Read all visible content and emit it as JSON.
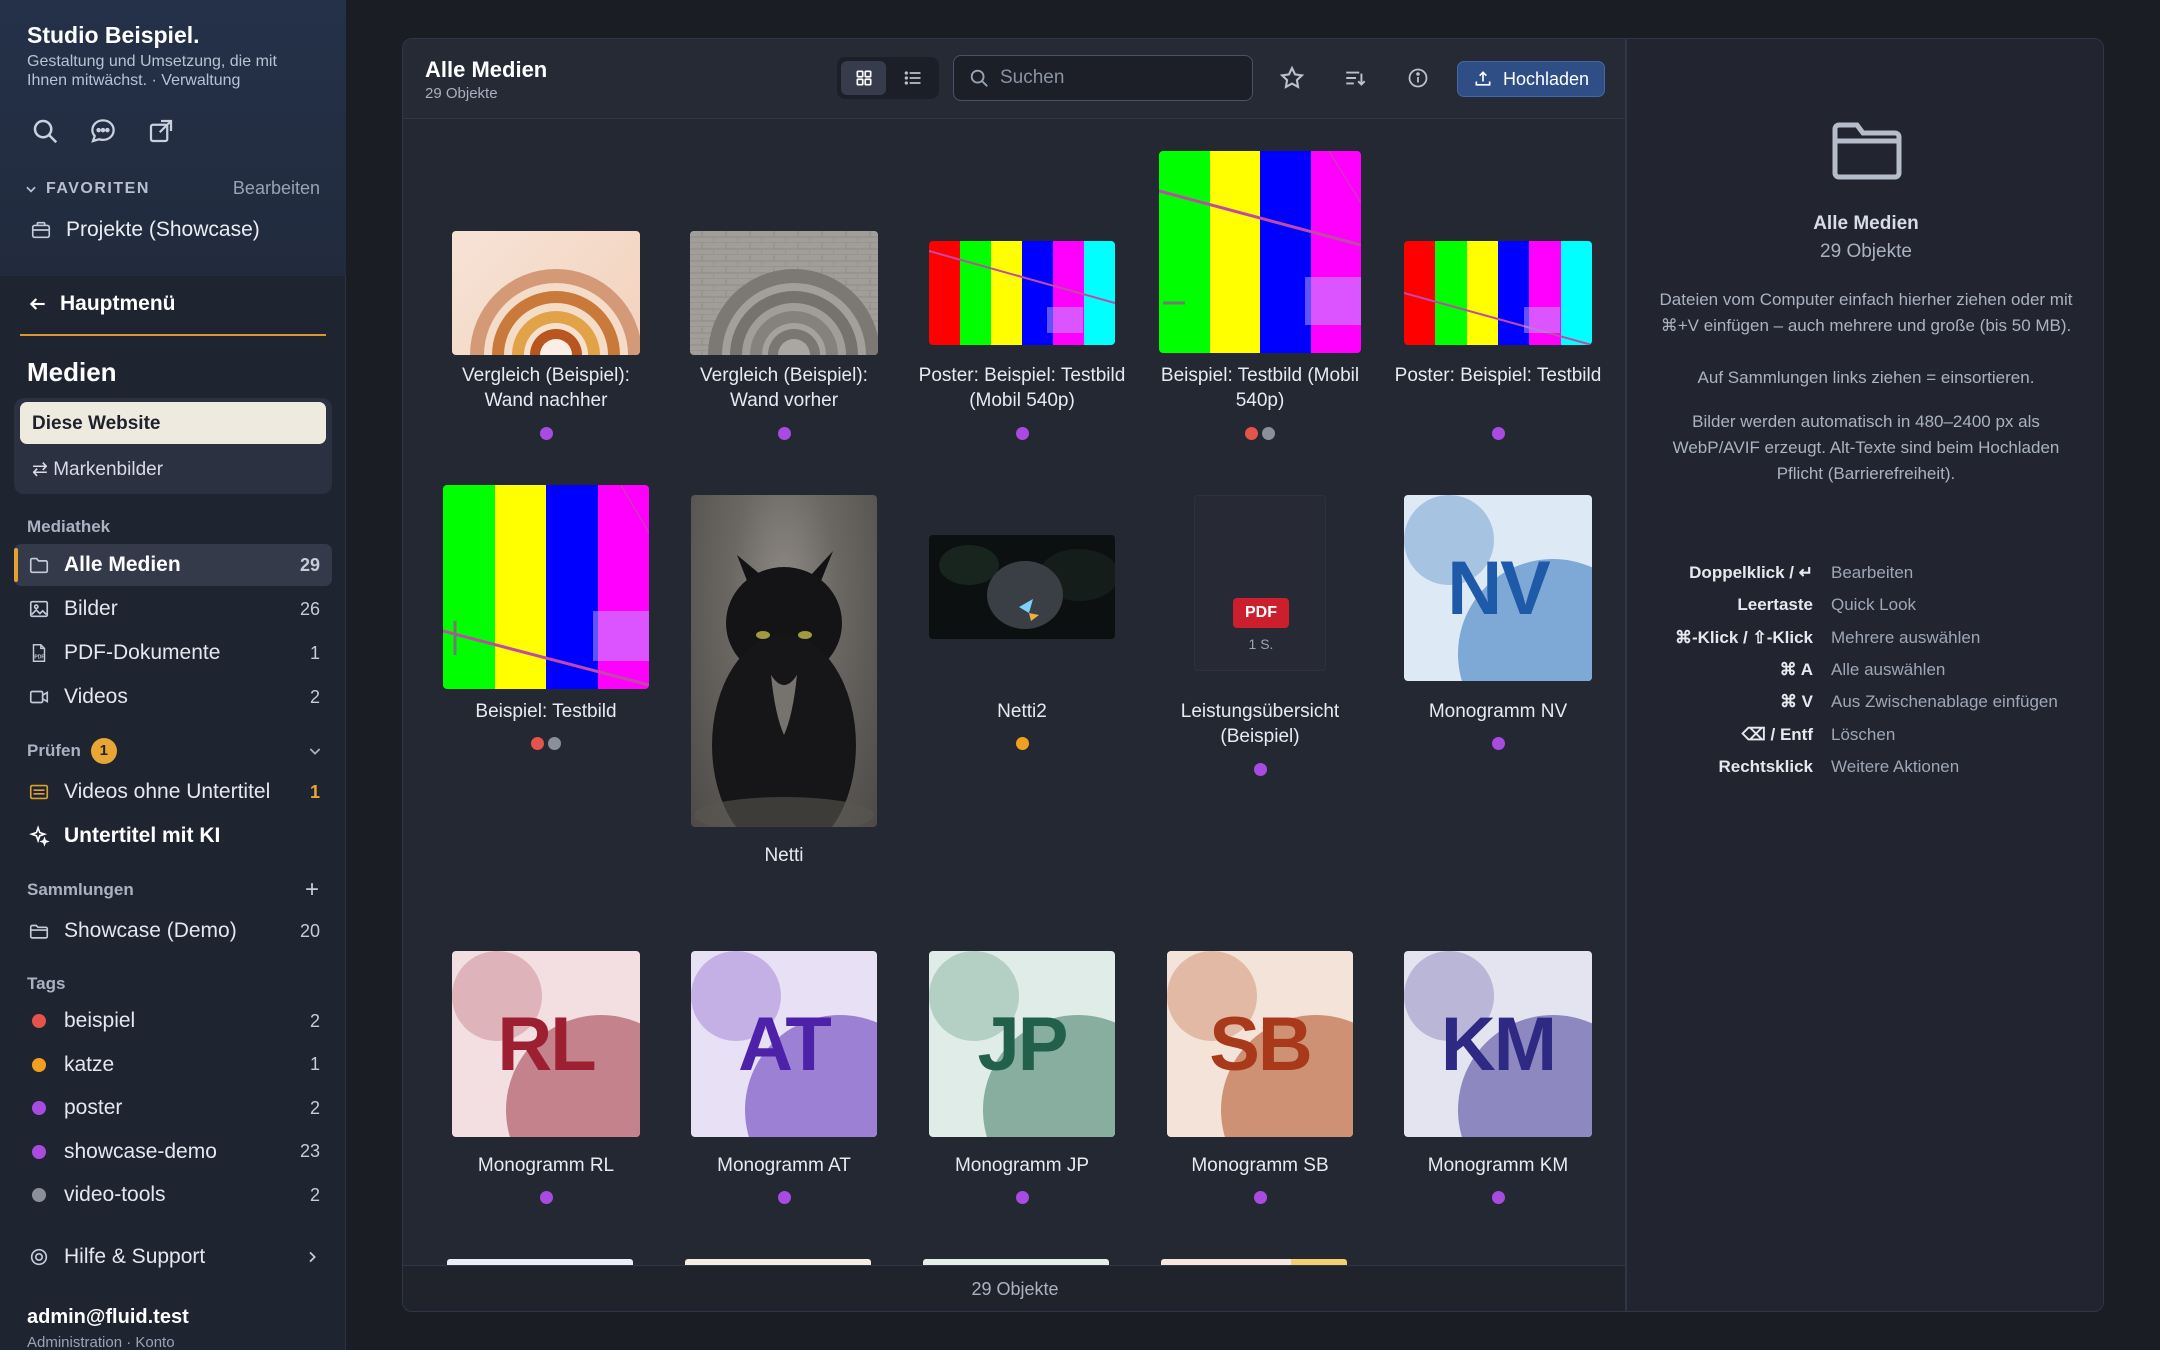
{
  "sidebar": {
    "brand": "Studio Beispiel.",
    "tagline": "Gestaltung und Umsetzung, die mit Ihnen mitwächst. · Verwaltung",
    "favorites_label": "FAVORITEN",
    "favorites_edit": "Bearbeiten",
    "favorite_item": "Projekte (Showcase)",
    "back_label": "Hauptmenü",
    "section_title": "Medien",
    "site_active": "Diese Website",
    "site_alt": "⇄ Markenbilder",
    "mediathek_label": "Mediathek",
    "mediathek": [
      {
        "label": "Alle Medien",
        "count": "29"
      },
      {
        "label": "Bilder",
        "count": "26"
      },
      {
        "label": "PDF-Dokumente",
        "count": "1"
      },
      {
        "label": "Videos",
        "count": "2"
      }
    ],
    "pruefen_label": "Prüfen",
    "pruefen_badge": "1",
    "pruefen_item": {
      "label": "Videos ohne Untertitel",
      "count": "1"
    },
    "ki_item": "Untertitel mit KI",
    "sammlungen_label": "Sammlungen",
    "sammlungen_add": "+",
    "sammlung": {
      "label": "Showcase (Demo)",
      "count": "20"
    },
    "tags_label": "Tags",
    "tags": [
      {
        "label": "beispiel",
        "count": "2",
        "color": "#e5534b"
      },
      {
        "label": "katze",
        "count": "1",
        "color": "#f0a020"
      },
      {
        "label": "poster",
        "count": "2",
        "color": "#a84be0"
      },
      {
        "label": "showcase-demo",
        "count": "23",
        "color": "#a84be0"
      },
      {
        "label": "video-tools",
        "count": "2",
        "color": "#8a8f99"
      }
    ],
    "help": "Hilfe & Support",
    "user": "admin@fluid.test",
    "user_sub": "Administration · Konto"
  },
  "toolbar": {
    "title": "Alle Medien",
    "subtitle": "29 Objekte",
    "search_placeholder": "Suchen",
    "upload_label": "Hochladen"
  },
  "grid": {
    "items": [
      {
        "caption": "Vergleich (Beispiel): Wand nachher",
        "dots": [
          "#a84be0"
        ]
      },
      {
        "caption": "Vergleich (Beispiel): Wand vorher",
        "dots": [
          "#a84be0"
        ]
      },
      {
        "caption": "Poster: Beispiel: Testbild (Mobil 540p)",
        "dots": [
          "#a84be0"
        ]
      },
      {
        "caption": "Beispiel: Testbild (Mobil 540p)",
        "dots": [
          "#e5534b",
          "#8a8f99"
        ]
      },
      {
        "caption": "Poster: Beispiel: Testbild",
        "dots": [
          "#a84be0"
        ]
      },
      {
        "caption": "Beispiel: Testbild",
        "dots": [
          "#e5534b",
          "#8a8f99"
        ]
      },
      {
        "caption": "Netti",
        "dots": []
      },
      {
        "caption": "Netti2",
        "dots": [
          "#f0a020"
        ]
      },
      {
        "caption": "Leistungsübersicht (Beispiel)",
        "dots": [
          "#a84be0"
        ],
        "pdf_label": "PDF",
        "pdf_pages": "1 S."
      },
      {
        "caption": "Monogramm NV",
        "dots": [
          "#a84be0"
        ],
        "mono": "NV"
      },
      {
        "caption": "Monogramm RL",
        "dots": [
          "#a84be0"
        ],
        "mono": "RL"
      },
      {
        "caption": "Monogramm AT",
        "dots": [
          "#a84be0"
        ],
        "mono": "AT"
      },
      {
        "caption": "Monogramm JP",
        "dots": [
          "#a84be0"
        ],
        "mono": "JP"
      },
      {
        "caption": "Monogramm SB",
        "dots": [
          "#a84be0"
        ],
        "mono": "SB"
      },
      {
        "caption": "Monogramm KM",
        "dots": [
          "#a84be0"
        ],
        "mono": "KM"
      }
    ],
    "footer": "29 Objekte"
  },
  "detail": {
    "title": "Alle Medien",
    "subtitle": "29 Objekte",
    "para1": "Dateien vom Computer einfach hierher ziehen oder mit ⌘+V einfügen – auch mehrere und große (bis 50 MB).",
    "para1b": "Auf Sammlungen links ziehen = einsortieren.",
    "para2": "Bilder werden automatisch in 480–2400 px als WebP/AVIF erzeugt. Alt-Texte sind beim Hochladen Pflicht (Barrierefreiheit).",
    "shortcuts": [
      {
        "key": "Doppelklick / ↵",
        "action": "Bearbeiten"
      },
      {
        "key": "Leertaste",
        "action": "Quick Look"
      },
      {
        "key": "⌘-Klick / ⇧-Klick",
        "action": "Mehrere auswählen"
      },
      {
        "key": "⌘ A",
        "action": "Alle auswählen"
      },
      {
        "key": "⌘ V",
        "action": "Aus Zwischenablage einfügen"
      },
      {
        "key": "⌫ / Entf",
        "action": "Löschen"
      },
      {
        "key": "Rechtsklick",
        "action": "Weitere Aktionen"
      }
    ]
  }
}
